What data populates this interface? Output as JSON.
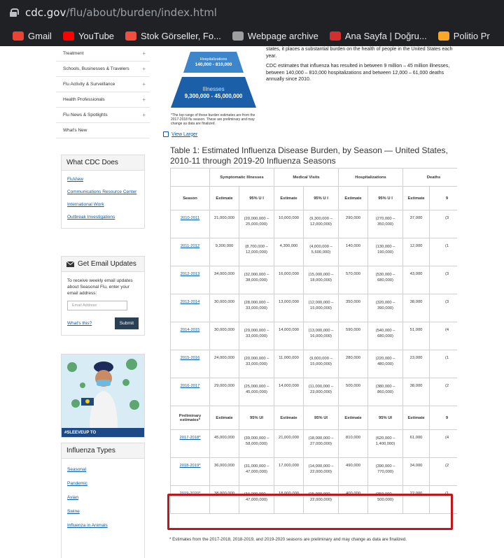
{
  "browser": {
    "url_host": "cdc.gov",
    "url_path": "/flu/about/burden/index.html",
    "bookmarks": [
      {
        "label": "Gmail",
        "icon": "gmail-icon",
        "color": "#ea4335"
      },
      {
        "label": "YouTube",
        "icon": "youtube-icon",
        "color": "#ff0000"
      },
      {
        "label": "Stok Görseller, Fo...",
        "icon": "stock-icon",
        "color": "#f04e3e"
      },
      {
        "label": "Webpage archive",
        "icon": "archive-icon",
        "color": "#9e9e9e"
      },
      {
        "label": "Ana Sayfa | Doğru...",
        "icon": "page-icon",
        "color": "#d32f2f"
      },
      {
        "label": "Politio Pr",
        "icon": "bulb-icon",
        "color": "#f9a825"
      }
    ]
  },
  "nav": {
    "items": [
      {
        "label": "Treatment",
        "plus": "+"
      },
      {
        "label": "Schools, Businesses & Travelers",
        "plus": "+"
      },
      {
        "label": "Flu Activity & Surveillance",
        "plus": "+"
      },
      {
        "label": "Health Professionals",
        "plus": "+"
      },
      {
        "label": "Flu News & Spotlights",
        "plus": "+"
      },
      {
        "label": "What's New",
        "plus": ""
      }
    ]
  },
  "what_cdc_does": {
    "title": "What CDC Does",
    "links": [
      "FluView",
      "Communications Resource Center",
      "International Work",
      "Outbreak Investigations"
    ]
  },
  "email": {
    "title": "Get Email Updates",
    "text": "To receive weekly email updates about Seasonal Flu, enter your email address:",
    "placeholder": "Email Address",
    "whats_this": "What's this?",
    "submit": "Submit"
  },
  "promo": {
    "tag": "#SLEEVEUP TO"
  },
  "influenza_types": {
    "title": "Influenza Types",
    "links": [
      "Seasonal",
      "Pandemic",
      "Avian",
      "Swine",
      "Influenza in Animals"
    ]
  },
  "pyramid": {
    "hosp_label": "Hospitalizations",
    "hosp_value": "140,000 - 810,000",
    "ill_label": "Illnesses",
    "ill_value": "9,300,000 - 45,000,000",
    "caption": "*The top range of these burden estimates are from the 2017-2018 flu season. These are preliminary and may change as data are finalized.",
    "colors": {
      "dark": "#1a5fa8",
      "light": "#3d86cc"
    }
  },
  "intro": {
    "p1": "states, it places a substantial burden on the health of people in the United States each year.",
    "p2": "CDC estimates that influenza has resulted in between 9 million – 45 million illnesses, between 140,000 – 810,000 hospitalizations and between 12,000 – 61,000 deaths annually since 2010."
  },
  "view_larger": "View Larger",
  "table": {
    "title": "Table 1: Estimated Influenza Disease Burden, by Season — United States, 2010-11 through 2019-20 Influenza Seasons",
    "groups": [
      "Symptomatic Illnesses",
      "Medical Visits",
      "Hospitalizations",
      "Deaths"
    ],
    "sub_headers": [
      "Season",
      "Estimate",
      "95% U I",
      "Estimate",
      "95% U I",
      "Estimate",
      "95% U I",
      "Estimate",
      "9"
    ],
    "prelim_header": [
      "Preliminary estimates*",
      "Estimate",
      "95% UI",
      "Estimate",
      "95% UI",
      "Estimate",
      "95% UI",
      "Estimate",
      "9"
    ],
    "final_rows": [
      {
        "season": "2010-2011",
        "ill": "21,000,000",
        "ill_ui": "(20,000,000 – 25,000,000)",
        "med": "10,000,000",
        "med_ui": "(9,300,000 – 12,000,000)",
        "hosp": "290,000",
        "hosp_ui": "(270,000 – 350,000)",
        "death": "37,000",
        "d9": "(3"
      },
      {
        "season": "2011-2012",
        "ill": "9,300,000",
        "ill_ui": "(8,700,000 – 12,000,000)",
        "med": "4,300,000",
        "med_ui": "(4,000,000 – 5,600,000)",
        "hosp": "140,000",
        "hosp_ui": "(130,000 – 190,000)",
        "death": "12,000",
        "d9": "(1"
      },
      {
        "season": "2012-2013",
        "ill": "34,000,000",
        "ill_ui": "(32,000,000 – 38,000,000)",
        "med": "16,000,000",
        "med_ui": "(15,000,000 – 18,000,000)",
        "hosp": "570,000",
        "hosp_ui": "(530,000 – 680,000)",
        "death": "43,000",
        "d9": "(3"
      },
      {
        "season": "2013-2014",
        "ill": "30,000,000",
        "ill_ui": "(28,000,000 – 33,000,000)",
        "med": "13,000,000",
        "med_ui": "(12,000,000 – 15,000,000)",
        "hosp": "350,000",
        "hosp_ui": "(320,000 – 390,000)",
        "death": "38,000",
        "d9": "(3"
      },
      {
        "season": "2014-2015",
        "ill": "30,000,000",
        "ill_ui": "(29,000,000 – 33,000,000)",
        "med": "14,000,000",
        "med_ui": "(13,000,000 – 16,000,000)",
        "hosp": "590,000",
        "hosp_ui": "(540,000 – 680,000)",
        "death": "51,000",
        "d9": "(4"
      },
      {
        "season": "2015-2016",
        "ill": "24,000,000",
        "ill_ui": "(20,000,000 – 33,000,000)",
        "med": "11,000,000",
        "med_ui": "(9,000,000 – 15,000,000)",
        "hosp": "280,000",
        "hosp_ui": "(220,000 – 480,000)",
        "death": "23,000",
        "d9": "(1"
      },
      {
        "season": "2016-2017",
        "ill": "29,000,000",
        "ill_ui": "(25,000,000 – 45,000,000)",
        "med": "14,000,000",
        "med_ui": "(11,000,000 – 23,000,000)",
        "hosp": "500,000",
        "hosp_ui": "(380,000 – 860,000)",
        "death": "38,000",
        "d9": "(2"
      }
    ],
    "prelim_rows": [
      {
        "season": "2017-2018*",
        "ill": "45,000,000",
        "ill_ui": "(39,000,000 – 58,000,000)",
        "med": "21,000,000",
        "med_ui": "(18,000,000 – 27,000,000)",
        "hosp": "810,000",
        "hosp_ui": "(620,000 – 1,400,000)",
        "death": "61,000",
        "d9": "(4"
      },
      {
        "season": "2018-2019*",
        "ill": "36,000,000",
        "ill_ui": "(31,000,000 – 47,000,000)",
        "med": "17,000,000",
        "med_ui": "(14,000,000 – 22,000,000)",
        "hosp": "490,000",
        "hosp_ui": "(390,000 – 770,000)",
        "death": "34,000",
        "d9": "(2"
      },
      {
        "season": "2019-2020*",
        "ill": "38,000,000",
        "ill_ui": "(34,000,000 – 47,000,000)",
        "med": "18,000,000",
        "med_ui": "(15,000,000 – 22,000,000)",
        "hosp": "400,000",
        "hosp_ui": "(350,000 – 500,000)",
        "death": "22,000",
        "d9": "(1"
      }
    ],
    "highlight_color": "#c0161c"
  },
  "footnote": "* Estimates from the 2017-2018, 2018-2019, and 2019-2020 seasons are preliminary and may change as data are finalized."
}
